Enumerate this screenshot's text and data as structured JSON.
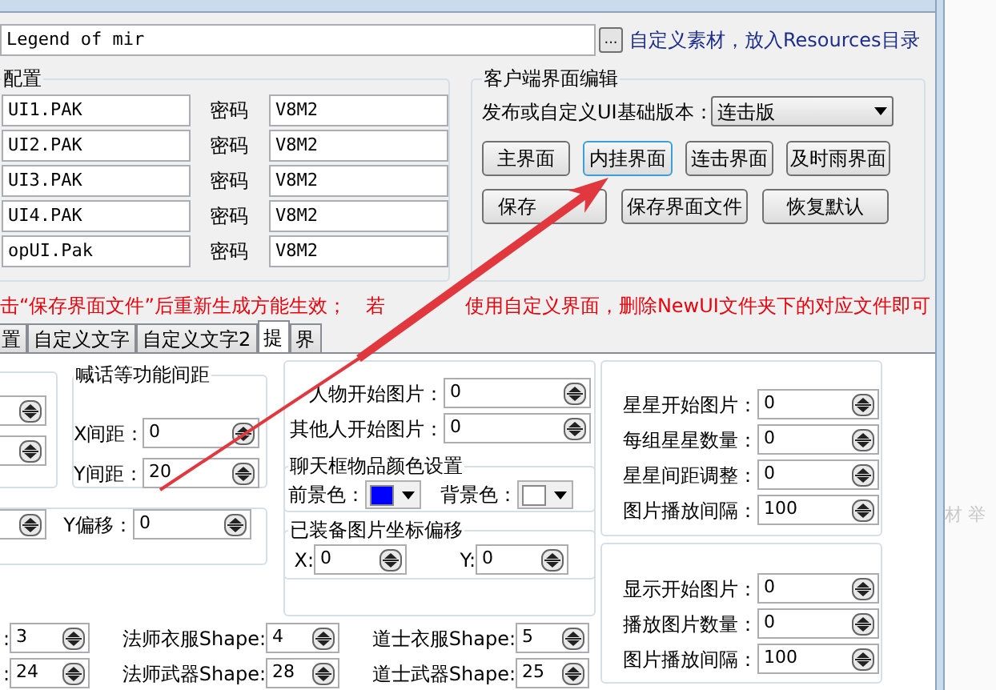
{
  "path_field": {
    "value": "Legend of mir"
  },
  "browse_button": "...",
  "resources_link": "自定义素材，放入Resources目录",
  "pak_group": {
    "title": "配置",
    "rows": [
      {
        "file": "UI1.PAK",
        "password_label": "密码",
        "password": "V8M2"
      },
      {
        "file": "UI2.PAK",
        "password_label": "密码",
        "password": "V8M2"
      },
      {
        "file": "UI3.PAK",
        "password_label": "密码",
        "password": "V8M2"
      },
      {
        "file": "UI4.PAK",
        "password_label": "密码",
        "password": "V8M2"
      },
      {
        "file": "opUI.Pak",
        "password_label": "密码",
        "password": "V8M2"
      }
    ]
  },
  "client_ui_group": {
    "title": "客户端界面编辑",
    "version_label": "发布或自定义UI基础版本：",
    "version": "连击版",
    "view_buttons": [
      {
        "label": "主界面",
        "selected": false
      },
      {
        "label": "内挂界面",
        "selected": true
      },
      {
        "label": "连击界面",
        "selected": false
      },
      {
        "label": "及时雨界面",
        "selected": false
      }
    ],
    "action_buttons": [
      {
        "label": "保存",
        "kind": "partly_covered"
      },
      {
        "label": "保存界面文件",
        "kind": "plain"
      },
      {
        "label": "恢复默认",
        "kind": "plain"
      }
    ]
  },
  "notice": [
    "击“保存界面文件”后重新生成方能生效；　若",
    "使用自定义界面，删除NewUI文件夹下的对应文件即可"
  ],
  "tabs": [
    {
      "label": "置",
      "selected": false
    },
    {
      "label": "自定义文字",
      "selected": false
    },
    {
      "label": "自定义文字2",
      "selected": false
    },
    {
      "label": "提",
      "selected": true
    },
    {
      "label": "界",
      "selected": false
    }
  ],
  "panel": {
    "spacing_group": {
      "title": "喊话等功能间距",
      "fields": [
        {
          "label": "X间距：",
          "value": "0"
        },
        {
          "label": "Y间距：",
          "value": "20"
        }
      ]
    },
    "offset_group": {
      "fields": [
        {
          "label": "Y偏移：",
          "value": "0"
        }
      ]
    },
    "image_fields": [
      {
        "label": "人物开始图片：",
        "value": "0"
      },
      {
        "label": "其他人开始图片：",
        "value": "0"
      }
    ],
    "color_group": {
      "title": "聊天框物品颜色设置",
      "swatches": [
        {
          "label": "前景色：",
          "color": "#0000ff"
        },
        {
          "label": "背景色：",
          "color": "#ffffff"
        }
      ]
    },
    "equip_offset_group": {
      "title": "已装备图片坐标偏移",
      "fields": [
        {
          "label": "X:",
          "value": "0"
        },
        {
          "label": "Y:",
          "value": "0"
        }
      ]
    },
    "star_group": {
      "fields": [
        {
          "label": "星星开始图片：",
          "value": "0"
        },
        {
          "label": "每组星星数量：",
          "value": "0"
        },
        {
          "label": "星星间距调整：",
          "value": "0"
        },
        {
          "label": "图片播放间隔：",
          "value": "100"
        }
      ]
    },
    "display_group": {
      "fields": [
        {
          "label": "显示开始图片：",
          "value": "0"
        },
        {
          "label": "播放图片数量：",
          "value": "0"
        },
        {
          "label": "图片播放间隔：",
          "value": "100"
        }
      ]
    },
    "shape_rows": [
      [
        {
          "label": ":",
          "value": "3"
        },
        {
          "label": "法师衣服Shape:",
          "value": "4"
        },
        {
          "label": "道士衣服Shape:",
          "value": "5"
        }
      ],
      [
        {
          "label": ":",
          "value": "24"
        },
        {
          "label": "法师武器Shape:",
          "value": "28"
        },
        {
          "label": "道士武器Shape:",
          "value": "25"
        }
      ]
    ]
  },
  "background_text": "材 举"
}
